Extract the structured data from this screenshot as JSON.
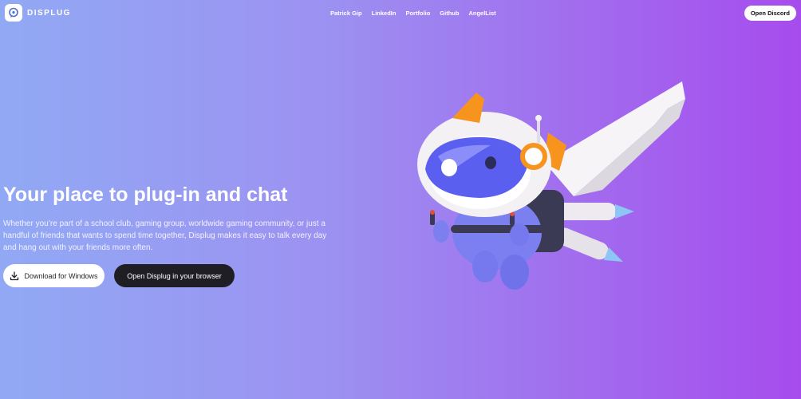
{
  "brand": {
    "name": "DISPLUG"
  },
  "nav": {
    "links": [
      "Patrick Gip",
      "LinkedIn",
      "Portfolio",
      "Github",
      "AngelList"
    ],
    "cta_label": "Open Discord"
  },
  "hero": {
    "title": "Your place to plug-in and chat",
    "description": "Whether you’re part of a school club, gaming group, worldwide gaming community, or just a handful of friends that wants to spend time together, Displug makes it easy to talk every day and hang out with your friends more often.",
    "download_label": "Download for Windows",
    "browser_label": "Open Displug in your browser"
  },
  "icons": {
    "logo": "chat-bubble-logo-icon",
    "download": "download-icon"
  },
  "colors": {
    "gradient_start": "#91a9f4",
    "gradient_end": "#a64ced",
    "dark_button": "#1f1e24",
    "mascot_body": "#7c7ff0",
    "mascot_accent": "#f7941d"
  }
}
